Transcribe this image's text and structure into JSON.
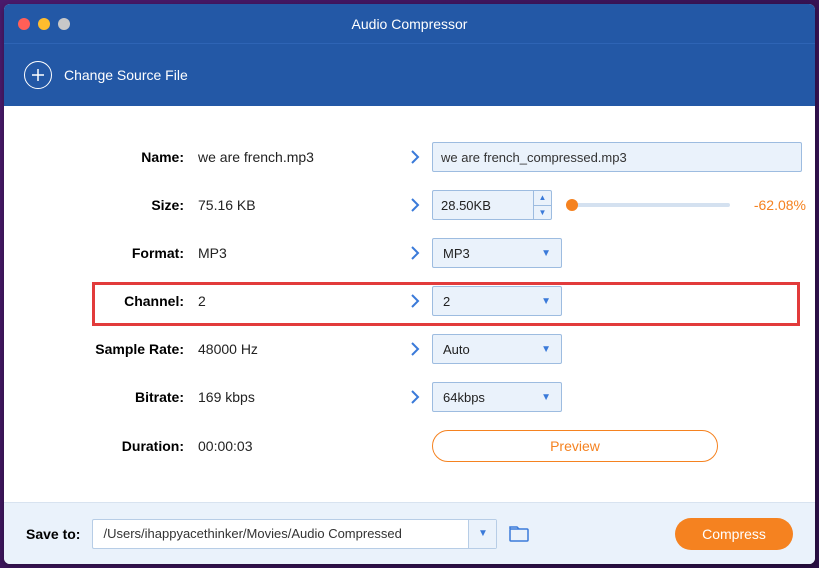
{
  "window": {
    "title": "Audio Compressor"
  },
  "toolbar": {
    "change_source": "Change Source File"
  },
  "rows": {
    "name": {
      "label": "Name:",
      "value": "we are french.mp3",
      "output": "we are french_compressed.mp3"
    },
    "size": {
      "label": "Size:",
      "value": "75.16 KB",
      "target": "28.50KB",
      "pct": "-62.08%"
    },
    "format": {
      "label": "Format:",
      "value": "MP3",
      "select": "MP3"
    },
    "channel": {
      "label": "Channel:",
      "value": "2",
      "select": "2"
    },
    "rate": {
      "label": "Sample Rate:",
      "value": "48000 Hz",
      "select": "Auto"
    },
    "bitrate": {
      "label": "Bitrate:",
      "value": "169 kbps",
      "select": "64kbps"
    },
    "duration": {
      "label": "Duration:",
      "value": "00:00:03"
    }
  },
  "actions": {
    "preview": "Preview",
    "compress": "Compress"
  },
  "footer": {
    "label": "Save to:",
    "path": "/Users/ihappyacethinker/Movies/Audio Compressed"
  }
}
